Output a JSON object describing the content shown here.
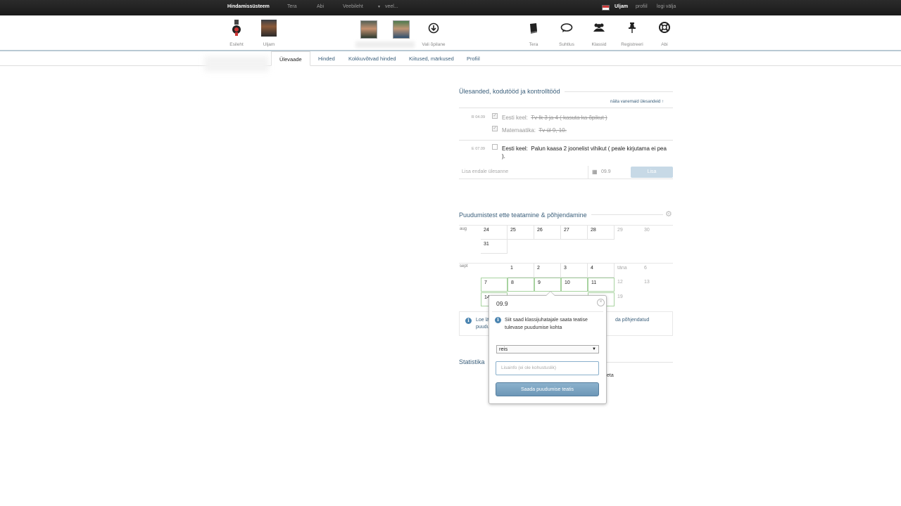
{
  "topbar": {
    "brand": "Hindamissüsteem",
    "nav": [
      "Tera",
      "Abi",
      "Veebileht",
      "veel..."
    ],
    "user": "Uljam",
    "profile": "profiil",
    "logout": "logi välja"
  },
  "iconbar": {
    "left": [
      {
        "label": "Esileht",
        "icon": "medal-icon"
      },
      {
        "label": "Uljam",
        "icon": "avatar"
      }
    ],
    "center_label": "Vali õpilane",
    "right": [
      {
        "label": "Tera",
        "icon": "book-icon"
      },
      {
        "label": "Suhtlus",
        "icon": "chat-icon"
      },
      {
        "label": "Klassid",
        "icon": "group-icon"
      },
      {
        "label": "Registreeri",
        "icon": "pin-icon"
      },
      {
        "label": "Abi",
        "icon": "lifebuoy-icon"
      }
    ]
  },
  "tabs": [
    "Ülevaade",
    "Hinded",
    "Kokkuvõtvad hinded",
    "Kiitused, märkused",
    "Profiil"
  ],
  "tasks": {
    "title": "Ülesanded, kodutööd ja kontrolltööd",
    "older_link": "näita vanemaid ülesandeid ↑",
    "groups": [
      {
        "date": "R 04.09",
        "items": [
          {
            "subject": "Eesti keel:",
            "text": "Tv lk 3 ja 4 ( kasuta ka õpikut )",
            "done": true
          },
          {
            "subject": "Matemaatika:",
            "text": "Tv ül 9, 10.",
            "done": true
          }
        ]
      },
      {
        "date": "E 07.09",
        "items": [
          {
            "subject": "Eesti keel:",
            "text": "Palun kaasa 2 joonelist vihikut ( peale kirjutama ei pea",
            "text2": ").",
            "done": false
          }
        ]
      }
    ],
    "add_placeholder": "Lisa endale ülesanne",
    "date_value": "09.9",
    "add_button": "Lisa"
  },
  "absence": {
    "title": "Puudumistest ette teatamine & põhjendamine",
    "months": [
      {
        "name": "aug",
        "rows": [
          [
            "24",
            "25",
            "26",
            "27",
            "28",
            "29",
            "30"
          ],
          [
            "31"
          ]
        ]
      },
      {
        "name": "sept",
        "rows": [
          [
            "",
            "1",
            "2",
            "3",
            "4",
            "täna",
            "6"
          ],
          [
            "7",
            "8",
            "9",
            "10",
            "11",
            "12",
            "13"
          ],
          [
            "14",
            "",
            "",
            "",
            "",
            "",
            "19"
          ]
        ]
      }
    ],
    "info_left_1": "Loe lä",
    "info_left_2": "puudu",
    "info_right": "da põhjendatud"
  },
  "stats": {
    "title": "Statistika",
    "fragment": "eta"
  },
  "popup": {
    "date": "09.9",
    "info": "Siit saad klassijuhatajale saata teatise tulevase puudumise kohta",
    "select_value": "reis",
    "input_placeholder": "Lisainfo (ei ole kohustuslik)",
    "submit": "Saada puudumise teatis"
  }
}
